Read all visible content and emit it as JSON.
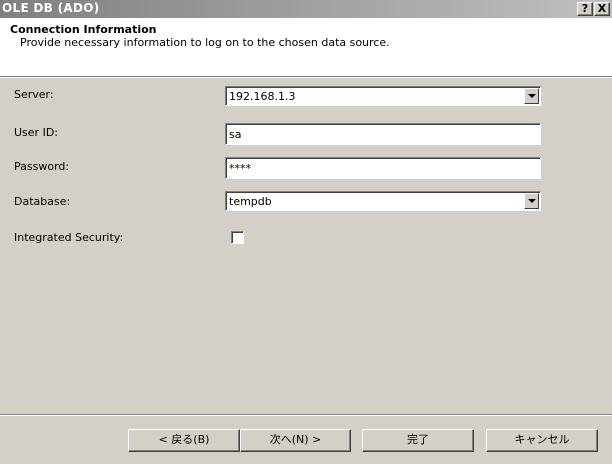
{
  "window": {
    "title": "OLE DB (ADO)",
    "help_label": "?",
    "close_label": "X"
  },
  "header": {
    "title": "Connection Information",
    "description": "Provide necessary information to log on to the chosen data source."
  },
  "form": {
    "server": {
      "label": "Server:",
      "value": "192.168.1.3"
    },
    "user_id": {
      "label": "User ID:",
      "value": "sa"
    },
    "password": {
      "label": "Password:",
      "value": "****"
    },
    "database": {
      "label": "Database:",
      "value": "tempdb"
    },
    "integrated_security": {
      "label": "Integrated Security:",
      "checked": false
    }
  },
  "buttons": {
    "back": "< 戻る(B)",
    "next": "次へ(N) >",
    "finish": "完了",
    "cancel": "キャンセル"
  }
}
